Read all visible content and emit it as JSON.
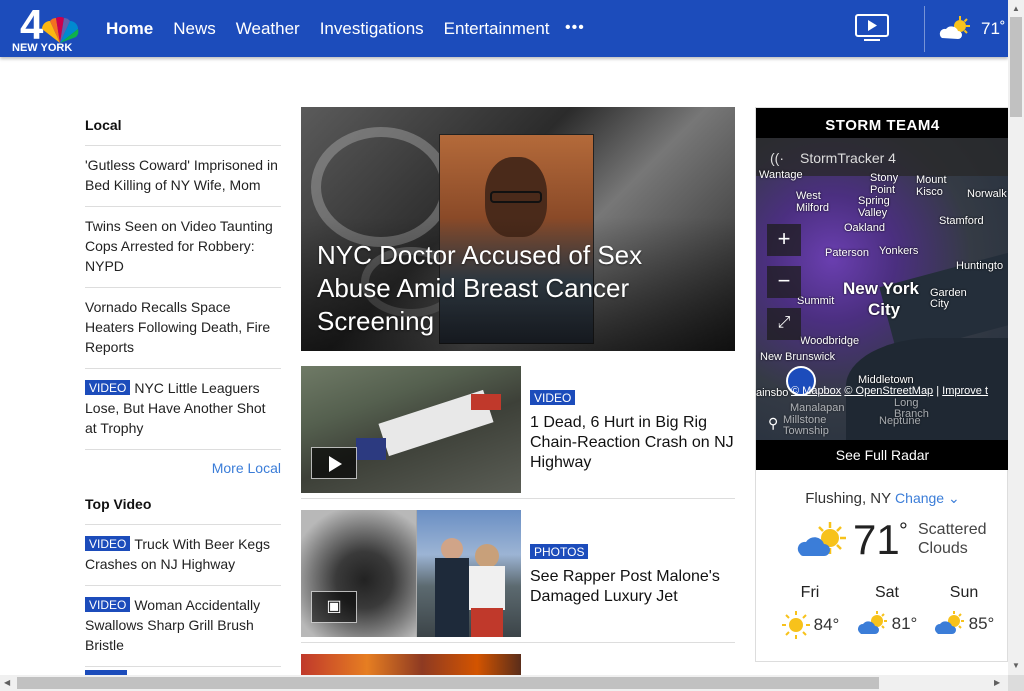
{
  "header": {
    "logo_number": "4",
    "logo_text": "NEW YORK",
    "nav": [
      "Home",
      "News",
      "Weather",
      "Investigations",
      "Entertainment"
    ],
    "more": "•••",
    "temp": "71˚"
  },
  "local": {
    "title": "Local",
    "stories": [
      {
        "badge": "",
        "text": "'Gutless Coward' Imprisoned in Bed Killing of NY Wife, Mom"
      },
      {
        "badge": "",
        "text": "Twins Seen on Video Taunting Cops Arrested for Robbery: NYPD"
      },
      {
        "badge": "",
        "text": "Vornado Recalls Space Heaters Following Death, Fire Reports"
      },
      {
        "badge": "VIDEO",
        "text": "NYC Little Leaguers Lose, But Have Another Shot at Trophy"
      }
    ],
    "more": "More Local"
  },
  "top_video": {
    "title": "Top Video",
    "stories": [
      {
        "badge": "VIDEO",
        "text": "Truck With Beer Kegs Crashes on NJ Highway"
      },
      {
        "badge": "VIDEO",
        "text": "Woman Accidentally Swallows Sharp Grill Brush Bristle"
      }
    ]
  },
  "hero": {
    "title": "NYC Doctor Accused of Sex Abuse Amid Breast Cancer Screening"
  },
  "cards": [
    {
      "badge": "VIDEO",
      "headline": "1 Dead, 6 Hurt in Big Rig Chain-Reaction Crash on NJ Highway"
    },
    {
      "badge": "PHOTOS",
      "headline": "See Rapper Post Malone's Damaged Luxury Jet"
    }
  ],
  "storm": {
    "title": "STORM TEAM4",
    "tracker": "StormTracker 4",
    "places": {
      "wantage": "Wantage",
      "west_milford": "West Milford",
      "mount_kisco": "Mount Kisco",
      "stony_point": "Stony Point",
      "spring_valley": "Spring Valley",
      "stamford": "Stamford",
      "norwalk": "Norwalk",
      "oakland": "Oakland",
      "paterson": "Paterson",
      "yonkers": "Yonkers",
      "huntington": "Huntingto",
      "new_york": "New York",
      "city": "City",
      "garden_city": "Garden City",
      "summit": "Summit",
      "new_brunswick": "New Brunswick",
      "woodbridge": "Woodbridge",
      "middletown": "Middletown",
      "plainsboro": "ainsbo",
      "manalapan": "Manalapan",
      "long_branch": "Long Branch",
      "millstone": "Millstone Township",
      "neptune": "Neptune"
    },
    "attribution": [
      "© Mapbox",
      "© OpenStreetMap",
      "Improve t"
    ],
    "full_radar": "See Full Radar",
    "location": "Flushing, NY",
    "change": "Change",
    "current_temp": "71",
    "current_deg": "°",
    "condition": "Scattered Clouds",
    "forecast": [
      {
        "day": "Fri",
        "temp": "84°",
        "icon": "sun-icon"
      },
      {
        "day": "Sat",
        "temp": "81°",
        "icon": "partly-cloudy-icon"
      },
      {
        "day": "Sun",
        "temp": "85°",
        "icon": "partly-cloudy-icon"
      }
    ]
  },
  "colors": {
    "brand": "#1c4cbb",
    "link": "#3b7dd8",
    "sun": "#f7c21b"
  }
}
